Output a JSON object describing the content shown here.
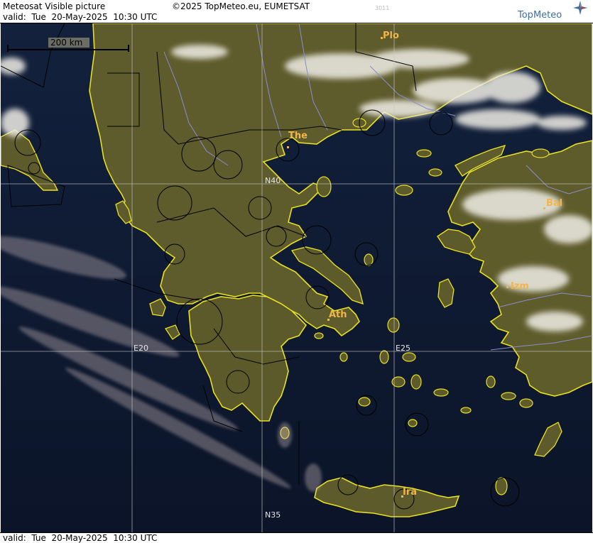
{
  "header": {
    "product": "Meteosat Visible picture",
    "copyright": "©2025 TopMeteo.eu, EUMETSAT",
    "valid_line": "valid:  Tue  20-May-2025  10:30 UTC",
    "code": "3011",
    "logo_text": "TopMeteo",
    "logo_icon": "compass-star-icon"
  },
  "footer": {
    "valid_line": "valid:  Tue  20-May-2025  10:30 UTC"
  },
  "map": {
    "scale_bar": "200 km",
    "grid_labels": {
      "n40": "N40",
      "n35": "N35",
      "e20": "E20",
      "e25": "E25"
    },
    "cities": {
      "plo": "Plo",
      "the": "The",
      "bal": "Bal",
      "izm": "Izm",
      "ath": "Ath",
      "ira": "Ira"
    },
    "colors": {
      "sea": "#0f1a33",
      "land": "#5a5a2a",
      "coast": "#e8e020",
      "rivers": "#8c8cd0",
      "borders": "#000000",
      "city_label": "#f3b54a",
      "cloud": "#f0eee6"
    }
  }
}
